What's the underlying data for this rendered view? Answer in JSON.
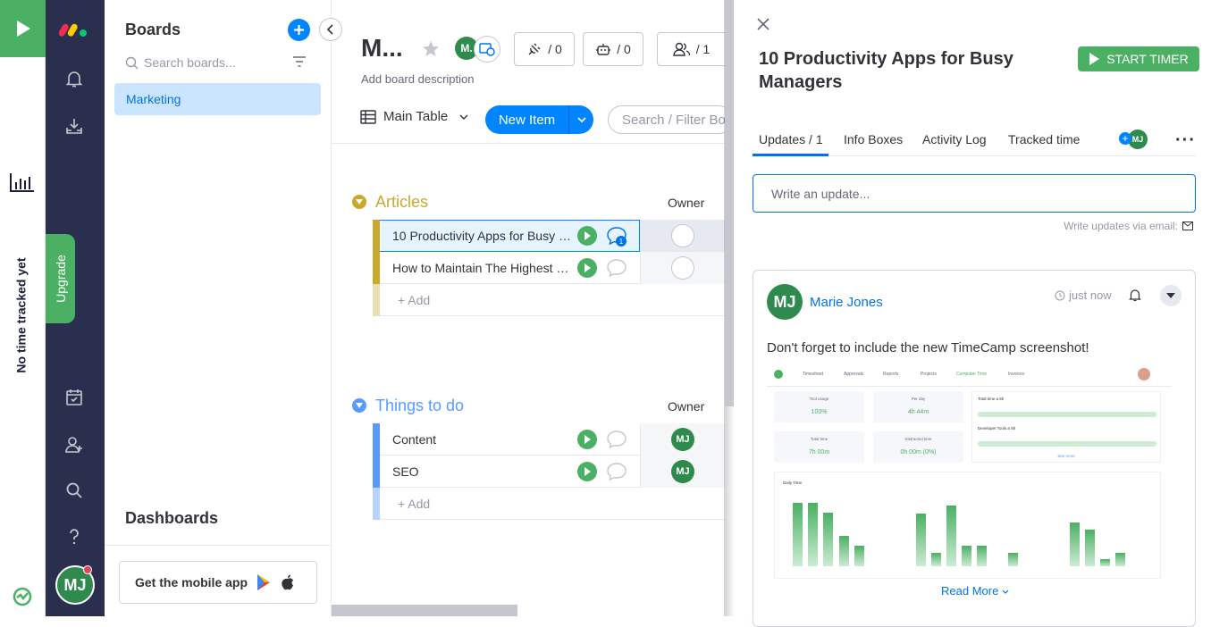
{
  "timecamp": {
    "status_text": "No time tracked yet"
  },
  "nav": {
    "upgrade_label": "Upgrade",
    "user_initials": "MJ"
  },
  "boards_panel": {
    "title": "Boards",
    "search_placeholder": "Search boards...",
    "items": [
      {
        "label": "Marketing",
        "selected": true
      }
    ],
    "dashboards_title": "Dashboards",
    "mobile_app_label": "Get the mobile app"
  },
  "board": {
    "title": "M...",
    "owner_initials": "M.",
    "description_placeholder": "Add board description",
    "integrations_count": "/ 0",
    "automations_count": "/ 0",
    "members_count": "/ 1",
    "view_label": "Main Table",
    "new_item_label": "New Item",
    "filter_placeholder": "Search / Filter Board",
    "owner_column": "Owner",
    "add_label": "+ Add",
    "groups": [
      {
        "title": "Articles",
        "color": "#c9a92c",
        "rows": [
          {
            "name": "10 Productivity Apps for Busy Ma...",
            "update_count": "1",
            "owner": ""
          },
          {
            "name": "How to Maintain The Highest Lev...",
            "update_count": "",
            "owner": ""
          }
        ]
      },
      {
        "title": "Things to do",
        "color": "#579bfc",
        "rows": [
          {
            "name": "Content",
            "update_count": "",
            "owner": "MJ"
          },
          {
            "name": "SEO",
            "update_count": "",
            "owner": "MJ"
          }
        ]
      }
    ]
  },
  "item_panel": {
    "title": "10 Productivity Apps for Busy Managers",
    "start_timer_label": "START TIMER",
    "tabs": [
      "Updates / 1",
      "Info Boxes",
      "Activity Log",
      "Tracked time"
    ],
    "subscriber_initials": "MJ",
    "update_placeholder": "Write an update...",
    "email_hint": "Write updates via email:",
    "post": {
      "author_initials": "MJ",
      "author": "Marie Jones",
      "time": "just now",
      "text": "Don't forget to include the new TimeCamp screenshot!",
      "read_more": "Read More"
    },
    "screenshot": {
      "tabs": [
        "Timesheet",
        "Approvals",
        "Reports",
        "Projects",
        "Computer Time",
        "Invoices"
      ],
      "cards": [
        {
          "label": "Tool usage",
          "value": "100%"
        },
        {
          "label": "Per day",
          "value": "4h 44m"
        },
        {
          "label": "Total time",
          "value": "7h 00m"
        },
        {
          "label": "Distracted time",
          "value": "0h 00m (0%)"
        }
      ],
      "side_title_1": "Total time a 5h",
      "side_title_2": "Developer Tools a 5h",
      "see_more": "See more",
      "daily_label": "Daily Time",
      "bars": [
        0.95,
        0.95,
        0.8,
        0.45,
        0.3,
        0,
        0,
        0,
        0.78,
        0.2,
        0.9,
        0.3,
        0.3,
        0,
        0.2,
        0,
        0,
        0,
        0.65,
        0.55,
        0.1,
        0.2,
        0
      ]
    }
  },
  "colors": {
    "timecamp_green": "#4bb063",
    "nav_bg": "#292f4c",
    "primary_blue": "#0085ff",
    "selected_board_bg": "#cce5ff"
  }
}
